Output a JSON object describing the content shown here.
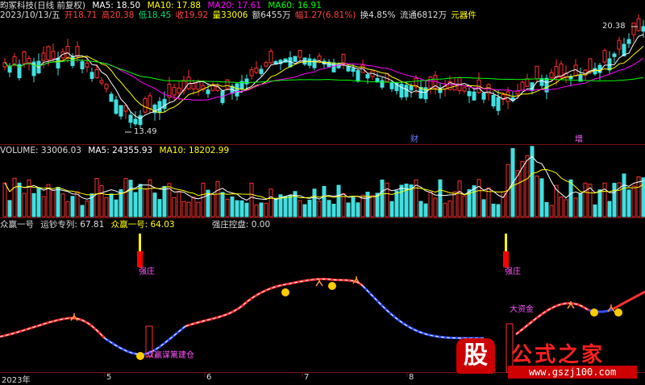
{
  "window_title": "昀冢科技(日线 前复权)",
  "ma_legend": [
    {
      "label": "MA5: 18.50",
      "color": "#ffffff"
    },
    {
      "label": "MA10: 17.88",
      "color": "#ffff00"
    },
    {
      "label": "MA20: 17.61",
      "color": "#ff00ff"
    },
    {
      "label": "MA60: 16.91",
      "color": "#00ff00"
    }
  ],
  "quote": {
    "date": "2023/10/13/五",
    "open": "开18.71",
    "high": "高20.38",
    "low": "低18.45",
    "close": "收19.92",
    "volume": "量33006",
    "amount": "额6455万",
    "change": "幅1.27(6.81%)",
    "turnover": "换4.85%",
    "float": "流通6812万",
    "sector": "元器件"
  },
  "price_marks": {
    "high": "20.38",
    "low": "13.49",
    "cai": "财",
    "zeng": "增"
  },
  "volume_legend": [
    {
      "label": "VOLUME: 33006.03",
      "color": "#dddddd"
    },
    {
      "label": "MA5: 24355.93",
      "color": "#ffffff"
    },
    {
      "label": "MA10: 18202.99",
      "color": "#ffff00"
    }
  ],
  "indicator_legend": {
    "name": "众赢一号",
    "a": "运钞专列: 67.81",
    "b": "众赢一号: 64.03",
    "c": "强庄控盘: 0.00",
    "colors": {
      "a": "#dddddd",
      "b": "#ffff00",
      "c": "#dddddd"
    }
  },
  "indicator_tags": {
    "qz1": "强庄",
    "qz2": "强庄",
    "buy": "众赢谋篱建仓",
    "dazijin": "大资金"
  },
  "x_axis": [
    "2023年",
    "5",
    "6",
    "7",
    "8"
  ],
  "logo": {
    "main": "股",
    "text": "公式之家",
    "url": "www.gszj100.com"
  }
}
